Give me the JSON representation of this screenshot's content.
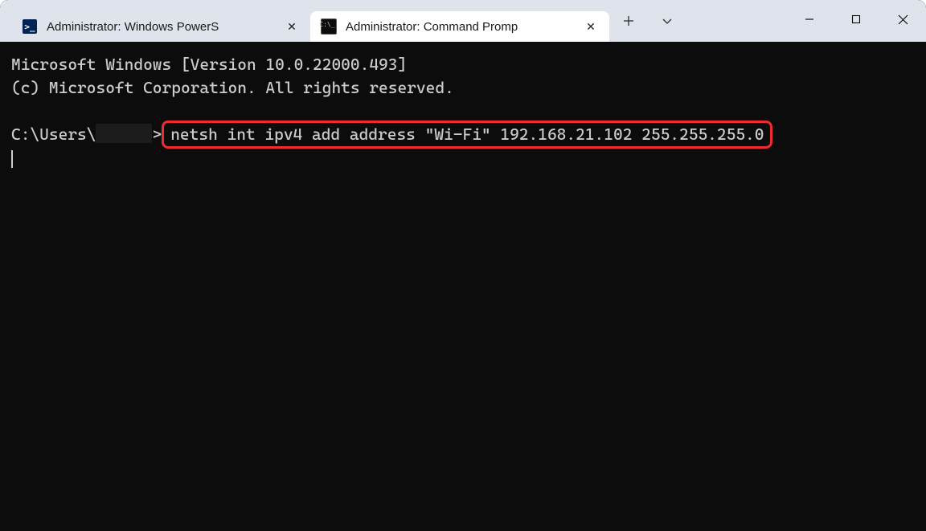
{
  "tabs": {
    "powershell": {
      "label": "Administrator: Windows PowerS"
    },
    "cmd": {
      "label": "Administrator: Command Promp"
    }
  },
  "icons": {
    "close_glyph": "✕",
    "plus_glyph": "＋"
  },
  "terminal": {
    "line1": "Microsoft Windows [Version 10.0.22000.493]",
    "line2": "(c) Microsoft Corporation. All rights reserved.",
    "prompt_prefix": "C:\\Users\\",
    "prompt_suffix": ">",
    "command": "netsh int ipv4 add address \"Wi-Fi\" 192.168.21.102 255.255.255.0"
  }
}
